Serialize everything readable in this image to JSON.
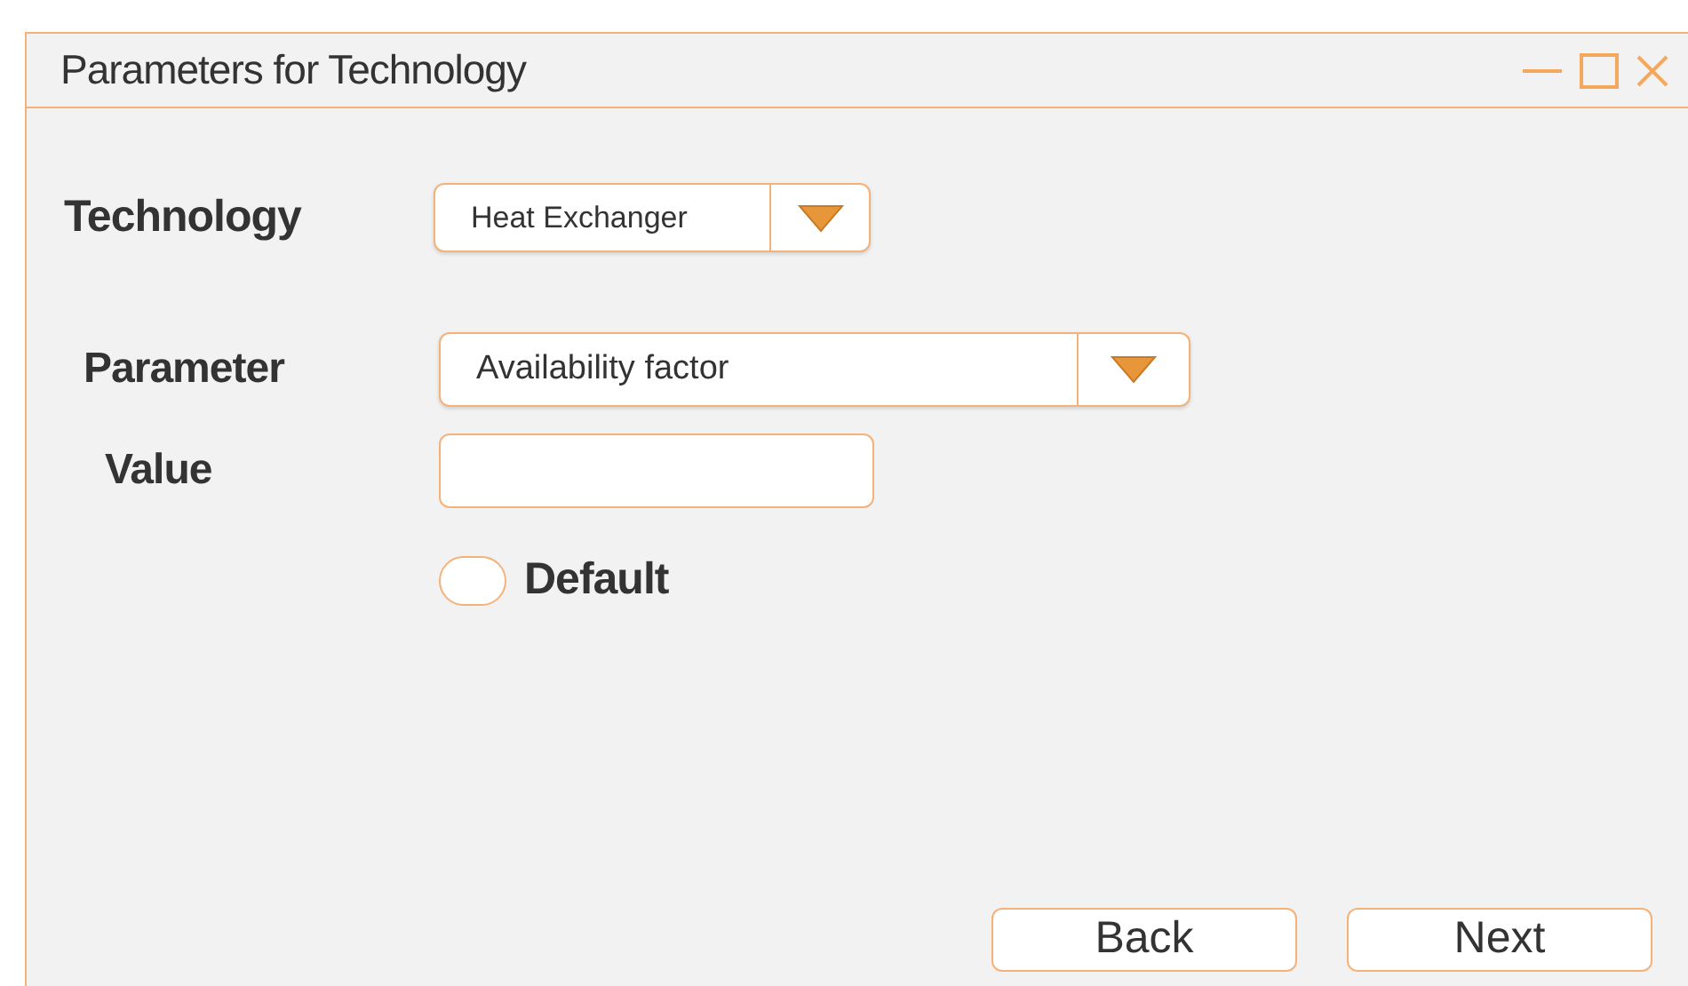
{
  "window": {
    "title": "Parameters for Technology"
  },
  "technology": {
    "label": "Technology",
    "value": "Heat Exchanger"
  },
  "parameter": {
    "label": "Parameter",
    "value": "Availability factor"
  },
  "value": {
    "label": "Value"
  },
  "default_option": {
    "label": "Default",
    "selected": false
  },
  "buttons": [
    {
      "label": "Back"
    },
    {
      "label": "Next"
    }
  ]
}
